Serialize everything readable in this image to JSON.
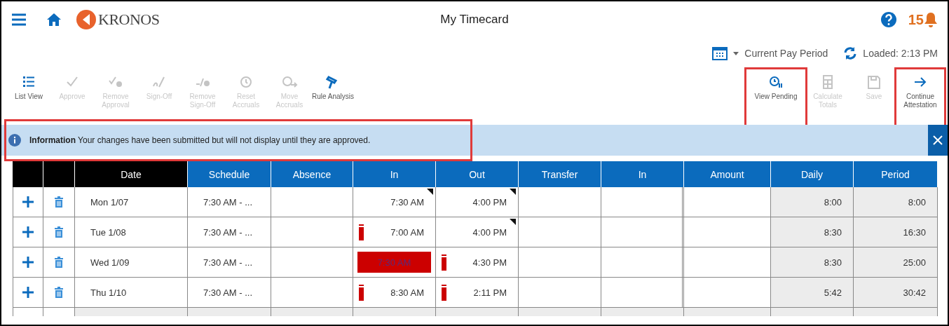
{
  "header": {
    "title": "My Timecard",
    "logo_text": "KRONOS",
    "notification_count": "15"
  },
  "period_bar": {
    "period": "Current Pay Period",
    "loaded": "Loaded: 2:13 PM"
  },
  "toolbar_left": [
    {
      "label": "List View",
      "disabled": false
    },
    {
      "label": "Approve",
      "disabled": true
    },
    {
      "label": "Remove Approval",
      "disabled": true
    },
    {
      "label": "Sign-Off",
      "disabled": true
    },
    {
      "label": "Remove Sign-Off",
      "disabled": true
    },
    {
      "label": "Reset Accruals",
      "disabled": true
    },
    {
      "label": "Move Accruals",
      "disabled": true
    },
    {
      "label": "Rule Analysis",
      "disabled": false
    }
  ],
  "toolbar_right": [
    {
      "label": "View Pending",
      "disabled": false,
      "highlighted": true
    },
    {
      "label": "Calculate Totals",
      "disabled": true,
      "highlighted": false
    },
    {
      "label": "Save",
      "disabled": true,
      "highlighted": false
    },
    {
      "label": "Continue Attestation",
      "disabled": false,
      "highlighted": true
    }
  ],
  "info_bar": {
    "text": "**Information** Your changes have been submitted but will not display until they are approved.",
    "highlighted": true
  },
  "table": {
    "columns": [
      {
        "color": "#000000"
      },
      {
        "color": "#000000"
      },
      {
        "label": "Date",
        "color": "#000000"
      },
      {
        "label": "Schedule",
        "color": "#0b6bbd"
      },
      {
        "label": "Absence",
        "color": "#0b6bbd"
      },
      {
        "label": "In",
        "color": "#0b6bbd"
      },
      {
        "label": "Out",
        "color": "#0b6bbd"
      },
      {
        "label": "Transfer",
        "color": "#0b6bbd"
      },
      {
        "label": "In",
        "color": "#0b6bbd"
      },
      {
        "label": "Amount",
        "color": "#0b6bbd"
      },
      {
        "label": "Daily",
        "color": "#0b6bbd"
      },
      {
        "label": "Period",
        "color": "#0b6bbd"
      }
    ],
    "rows": [
      {
        "date": "Mon 1/07",
        "schedule": "7:30 AM - ...",
        "in": {
          "value": "7:30 AM",
          "exception": false,
          "edited": true,
          "selected": false
        },
        "out": {
          "value": "4:00 PM",
          "exception": false,
          "edited": true
        },
        "daily": "8:00",
        "period": "8:00"
      },
      {
        "date": "Tue 1/08",
        "schedule": "7:30 AM - ...",
        "in": {
          "value": "7:00 AM",
          "exception": true,
          "edited": false,
          "selected": false
        },
        "out": {
          "value": "4:00 PM",
          "exception": false,
          "edited": true
        },
        "daily": "8:30",
        "period": "16:30"
      },
      {
        "date": "Wed 1/09",
        "schedule": "7:30 AM - ...",
        "in": {
          "value": "7:30 AM",
          "exception": false,
          "edited": false,
          "selected": true
        },
        "out": {
          "value": "4:30 PM",
          "exception": true,
          "edited": false
        },
        "daily": "8:30",
        "period": "25:00"
      },
      {
        "date": "Thu 1/10",
        "schedule": "7:30 AM - ...",
        "in": {
          "value": "8:30 AM",
          "exception": true,
          "edited": false,
          "selected": false
        },
        "out": {
          "value": "2:11 PM",
          "exception": true,
          "edited": false
        },
        "daily": "5:42",
        "period": "30:42"
      }
    ]
  }
}
